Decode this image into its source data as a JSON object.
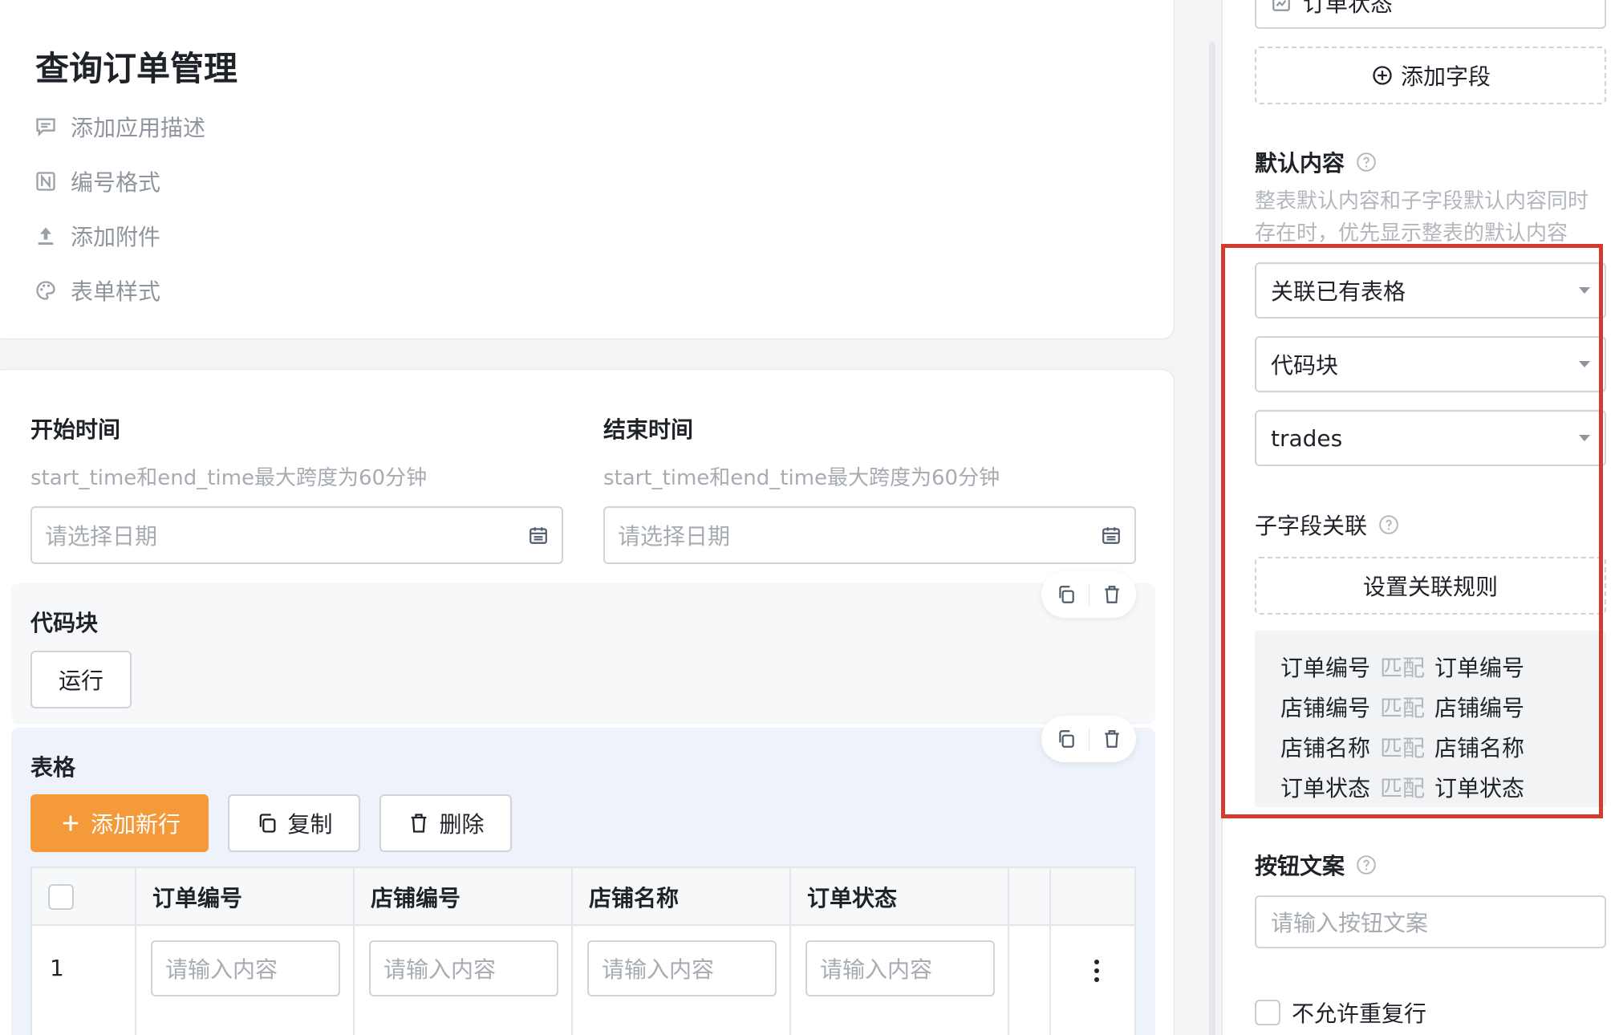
{
  "header": {
    "title": "查询订单管理",
    "items": [
      {
        "icon": "comment-icon",
        "label": "添加应用描述"
      },
      {
        "icon": "number-format-icon",
        "label": "编号格式"
      },
      {
        "icon": "upload-icon",
        "label": "添加附件"
      },
      {
        "icon": "palette-icon",
        "label": "表单样式"
      }
    ]
  },
  "form": {
    "start": {
      "label": "开始时间",
      "hint": "start_time和end_time最大跨度为60分钟",
      "placeholder": "请选择日期"
    },
    "end": {
      "label": "结束时间",
      "hint": "start_time和end_time最大跨度为60分钟",
      "placeholder": "请选择日期"
    },
    "code_block": {
      "title": "代码块",
      "run_label": "运行"
    },
    "table_block": {
      "title": "表格",
      "add_row_label": "添加新行",
      "copy_label": "复制",
      "delete_label": "删除",
      "columns": [
        "订单编号",
        "店铺编号",
        "店铺名称",
        "订单状态"
      ],
      "rows": [
        {
          "num": "1",
          "placeholder": "请输入内容"
        }
      ]
    }
  },
  "right_panel": {
    "top_field_partial": "订单状态",
    "add_field_label": "添加字段",
    "default_content": {
      "label": "默认内容",
      "desc": "整表默认内容和子字段默认内容同时存在时，优先显示整表的默认内容"
    },
    "selects": [
      "关联已有表格",
      "代码块",
      "trades"
    ],
    "sub_field": {
      "label": "子字段关联",
      "rule_button": "设置关联规则",
      "match_word": "匹配",
      "mappings": [
        {
          "from": "订单编号",
          "to": "订单编号"
        },
        {
          "from": "店铺编号",
          "to": "店铺编号"
        },
        {
          "from": "店铺名称",
          "to": "店铺名称"
        },
        {
          "from": "订单状态",
          "to": "订单状态"
        }
      ]
    },
    "button_text": {
      "label": "按钮文案",
      "placeholder": "请输入按钮文案"
    },
    "no_duplicate": {
      "label": "不允许重复行"
    }
  },
  "colors": {
    "primary": "#f59a3b",
    "highlight_frame": "#d23b2f"
  }
}
